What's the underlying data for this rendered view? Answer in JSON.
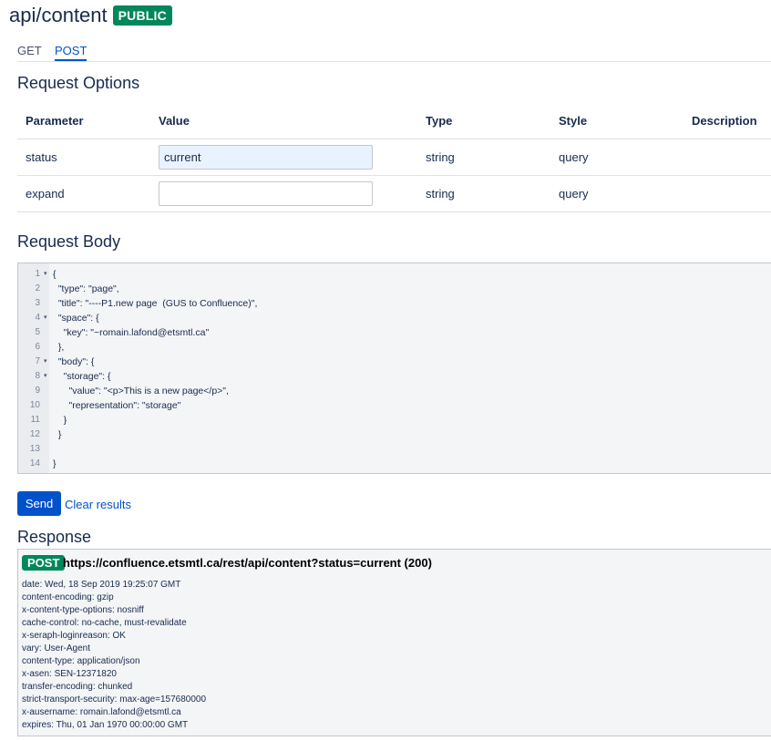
{
  "page": {
    "title": "api/content",
    "badge": "PUBLIC"
  },
  "tabs": [
    {
      "label": "GET"
    },
    {
      "label": "POST"
    }
  ],
  "sections": {
    "request_options": "Request Options",
    "request_body": "Request Body",
    "response": "Response"
  },
  "params": {
    "headers": [
      "Parameter",
      "Value",
      "Type",
      "Style",
      "Description"
    ],
    "rows": [
      {
        "name": "status",
        "value": "current",
        "type": "string",
        "style": "query"
      },
      {
        "name": "expand",
        "value": "",
        "type": "string",
        "style": "query"
      }
    ]
  },
  "code_lines": [
    {
      "n": "1",
      "text": "{",
      "fold": true
    },
    {
      "n": "2",
      "text": "  \"type\": \"page\",",
      "fold": false
    },
    {
      "n": "3",
      "text": "  \"title\": \"----P1.new page  (GUS to Confluence)\",",
      "fold": false
    },
    {
      "n": "4",
      "text": "  \"space\": {",
      "fold": true
    },
    {
      "n": "5",
      "text": "    \"key\": \"~romain.lafond@etsmtl.ca\"",
      "fold": false
    },
    {
      "n": "6",
      "text": "  },",
      "fold": false
    },
    {
      "n": "7",
      "text": "  \"body\": {",
      "fold": true
    },
    {
      "n": "8",
      "text": "    \"storage\": {",
      "fold": true
    },
    {
      "n": "9",
      "text": "      \"value\": \"<p>This is a new page</p>\",",
      "fold": false
    },
    {
      "n": "10",
      "text": "      \"representation\": \"storage\"",
      "fold": false
    },
    {
      "n": "11",
      "text": "    }",
      "fold": false
    },
    {
      "n": "12",
      "text": "  }",
      "fold": false
    },
    {
      "n": "13",
      "text": "",
      "fold": false
    },
    {
      "n": "14",
      "text": "}",
      "fold": false
    }
  ],
  "fold_glyph": "▾",
  "actions": {
    "send": "Send",
    "clear": "Clear results"
  },
  "response": {
    "method": "POST",
    "url": "https://confluence.etsmtl.ca/rest/api/content?status=current (200)",
    "headers": [
      "date: Wed, 18 Sep 2019 19:25:07 GMT",
      "content-encoding: gzip",
      "x-content-type-options: nosniff",
      "cache-control: no-cache, must-revalidate",
      "x-seraph-loginreason: OK",
      "vary: User-Agent",
      "content-type: application/json",
      "x-asen: SEN-12371820",
      "transfer-encoding: chunked",
      "strict-transport-security: max-age=157680000",
      "x-ausername: romain.lafond@etsmtl.ca",
      "expires: Thu, 01 Jan 1970 00:00:00 GMT"
    ]
  },
  "colors": {
    "accent": "#0052cc",
    "success": "#00875a"
  }
}
